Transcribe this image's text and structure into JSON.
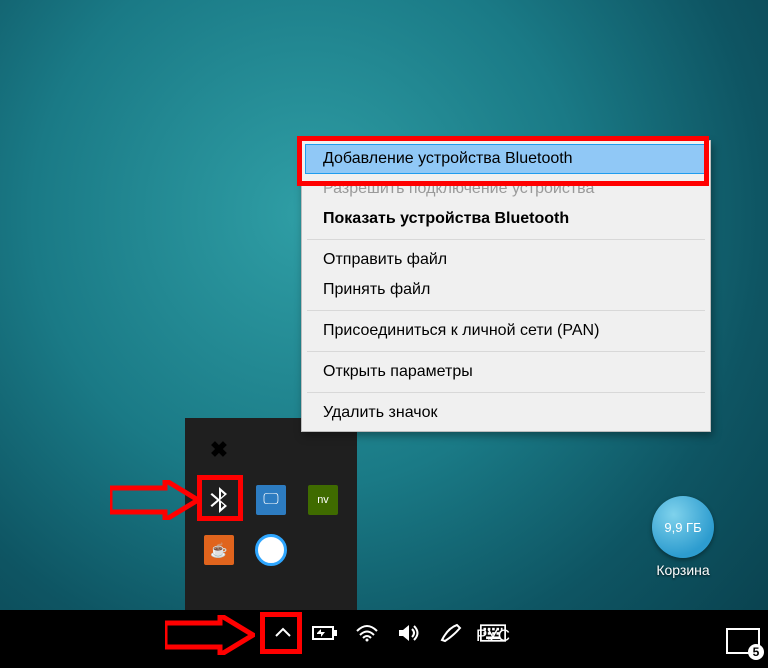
{
  "context_menu": {
    "items": [
      {
        "label": "Добавление устройства Bluetooth",
        "state": "selected"
      },
      {
        "label": "Разрешить подключение устройства",
        "state": "disabled"
      },
      {
        "label": "Показать устройства Bluetooth",
        "state": "bold"
      }
    ],
    "items2": [
      {
        "label": "Отправить файл"
      },
      {
        "label": "Принять файл"
      }
    ],
    "items3": [
      {
        "label": "Присоединиться к личной сети (PAN)"
      }
    ],
    "items4": [
      {
        "label": "Открыть параметры"
      }
    ],
    "items5": [
      {
        "label": "Удалить значок"
      }
    ]
  },
  "recycle_bin": {
    "size_label": "9,9 ГБ",
    "name": "Корзина"
  },
  "taskbar": {
    "language": "РУС",
    "notification_count": "5"
  },
  "tray_icons": {
    "bluetooth": "bluetooth-icon",
    "display": "display-icon",
    "nvidia": "nvidia-icon",
    "java": "java-icon",
    "cortana": "cortana-icon",
    "disabled_touch": "touch-disabled-icon"
  }
}
